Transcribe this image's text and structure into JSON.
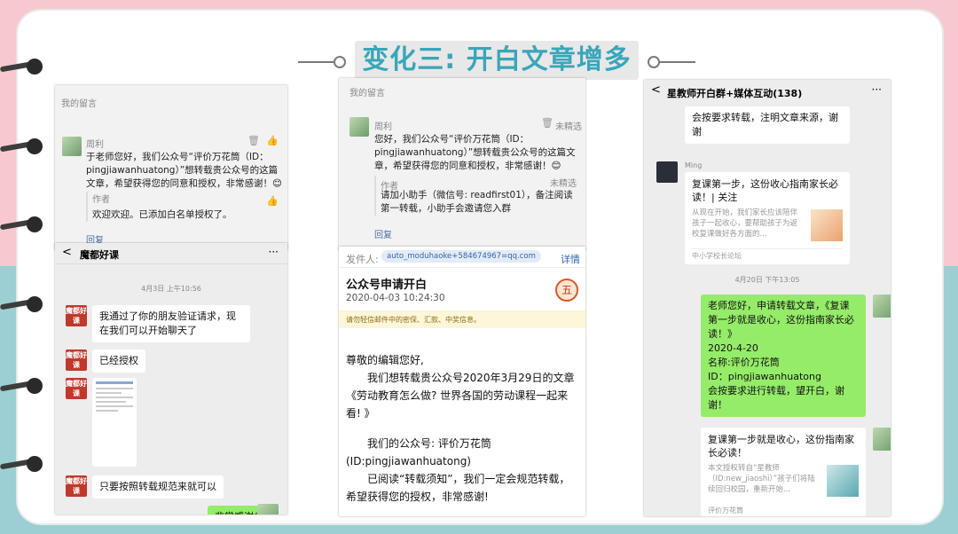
{
  "title": "变化三: 开白文章增多",
  "colors": {
    "accent": "#3aa6b9",
    "pink_bg": "#f7c9cf",
    "teal_bg": "#9bcfd3",
    "wechat_green": "#95ec69"
  },
  "panel1": {
    "section_label": "我的留言",
    "commenter": "周利",
    "comment": "于老师您好，我们公众号“评价万花筒（ID：pingjiawanhuatong）”想转载贵公众号的这篇文章，希望获得您的同意和授权，非常感谢！😊",
    "author_label": "作者",
    "author_reply": "欢迎欢迎。已添加白名单授权了。",
    "reply_link": "回复"
  },
  "panel2": {
    "back": "<",
    "chat_title": "魔都好课",
    "more": "···",
    "time": "4月3日 上午10:56",
    "avatar_text": "魔都好课",
    "messages": [
      "我通过了你的朋友验证请求，现在我们可以开始聊天了",
      "已经授权",
      "只要按照转载规范来就可以"
    ],
    "my_message": "非常感谢😊"
  },
  "panel3": {
    "section_label": "我的留言",
    "commenter": "周利",
    "not_featured": "未精选",
    "comment": "您好，我们公众号“评价万花筒（ID：pingjiawanhuatong）”想转载贵公众号的这篇文章，希望获得您的同意和授权，非常感谢！😊",
    "author_label": "作者",
    "author_not_featured": "未精选",
    "author_reply": "请加小助手（微信号: readfirst01），备注阅读第一转载，小助手会邀请您入群",
    "reply_link": "回复"
  },
  "panel4": {
    "sender_label": "发件人:",
    "sender": "auto_moduhaoke+584674967=qq.com",
    "details": "详情",
    "subject": "公众号申请开白",
    "date": "2020-04-03 10:24:30",
    "warning": "请勿轻信邮件中的密保、汇款、中奖信息。",
    "greeting": "尊敬的编辑您好,",
    "body1": "我们想转载贵公众号2020年3月29日的文章《劳动教育怎么做? 世界各国的劳动课程一起来看! 》",
    "body2": "我们的公众号: 评价万花筒",
    "body3": "(ID:pingjiawanhuatong)",
    "body4": "已阅读“转载须知”，我们一定会规范转载，希望获得您的授权，非常感谢!"
  },
  "panel5": {
    "back": "<",
    "chat_title": "星教师开白群+媒体互动(138)",
    "more": "···",
    "top_msg": "会按要求转载，注明文章来源，谢谢",
    "sender_name": "Ming",
    "card1_title": "复课第一步，这份收心指南家长必读！| 关注",
    "card1_desc": "从现在开始，我们家长应该陪伴孩子一起收心，要帮助孩子为返校复课做好各方面的...",
    "card1_source": "中小学校长论坛",
    "time": "4月20日 下午13:05",
    "my_message": "老师您好，申请转载文章，《复课第一步就是收心，这份指南家长必读！》\n2020-4-20\n名称:评价万花筒\nID：pingjiawanhuatong\n会按要求进行转载，望开白，谢谢！",
    "card2_title": "复课第一步就是收心，这份指南家长必读！",
    "card2_desc": "本文授权转自“星教师（ID:new_jiaoshi）”孩子们将陆续回归校园，重新开始...",
    "card2_source": "评价万花筒"
  }
}
